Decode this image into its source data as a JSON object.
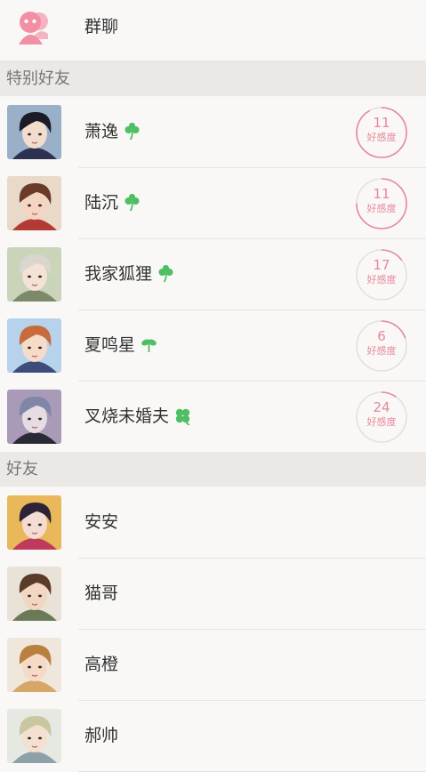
{
  "group": {
    "label": "群聊",
    "icon": "group-chat-icon",
    "accent": "#f28fa4"
  },
  "sections": {
    "special": "特别好友",
    "friends": "好友"
  },
  "affinity_label": "好感度",
  "colors": {
    "ring": "#e58a9a",
    "ring_track": "#e4e0de",
    "clover": "#4fbf63"
  },
  "special_friends": [
    {
      "name": "萧逸",
      "affinity": "11",
      "clover": "three-leaf-clover-icon",
      "affinity_fill": 0.92,
      "palette": [
        "#1b1c28",
        "#f2dccd",
        "#2d3250",
        "#9ab0c8"
      ]
    },
    {
      "name": "陆沉",
      "affinity": "11",
      "clover": "three-leaf-clover-icon",
      "affinity_fill": 0.75,
      "palette": [
        "#6b3a2a",
        "#f4d5c2",
        "#b23b35",
        "#e9d9c8"
      ]
    },
    {
      "name": "我家狐狸",
      "affinity": "17",
      "clover": "three-leaf-clover-icon",
      "affinity_fill": 0.15,
      "palette": [
        "#d9d6cf",
        "#f3e2d5",
        "#7c8a6a",
        "#c9d4b9"
      ]
    },
    {
      "name": "夏鸣星",
      "affinity": "6",
      "clover": "two-leaf-sprout-icon",
      "affinity_fill": 0.2,
      "palette": [
        "#c86a3c",
        "#f6dcc8",
        "#3d4d7a",
        "#b7d3ec"
      ]
    },
    {
      "name": "叉烧未婚夫",
      "affinity": "24",
      "clover": "four-leaf-clover-icon",
      "affinity_fill": 0.1,
      "palette": [
        "#7f86a8",
        "#e6dde4",
        "#2a2a36",
        "#a99ab7"
      ]
    }
  ],
  "friends": [
    {
      "name": "安安",
      "palette": [
        "#2d2238",
        "#f4dcd4",
        "#c03a5c",
        "#e8b85a"
      ]
    },
    {
      "name": "猫哥",
      "palette": [
        "#5a3a28",
        "#f2d6c2",
        "#6a7a58",
        "#e9e2d8"
      ]
    },
    {
      "name": "高橙",
      "palette": [
        "#b9803f",
        "#f5dbc5",
        "#d7a76a",
        "#efe7dc"
      ]
    },
    {
      "name": "郝帅",
      "palette": [
        "#c9c6a0",
        "#f3e0d0",
        "#8ea1a8",
        "#e6e9e2"
      ]
    }
  ]
}
